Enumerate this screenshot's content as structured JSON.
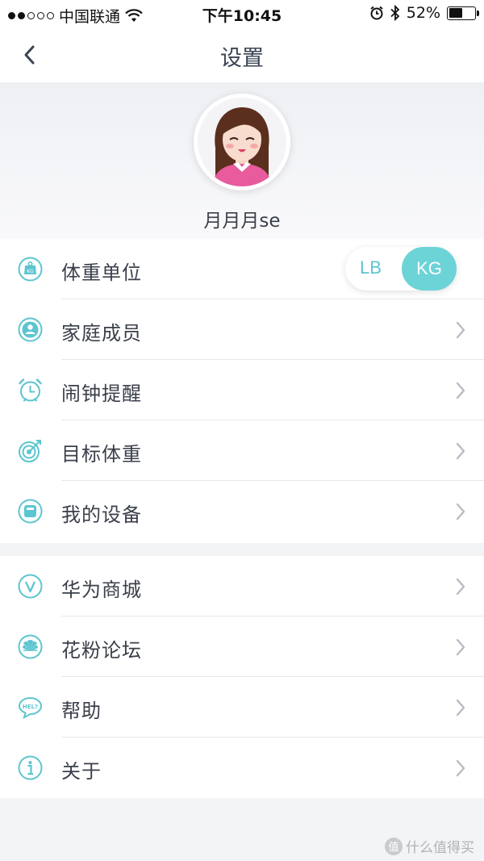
{
  "status_bar": {
    "carrier": "中国联通",
    "time": "下午10:45",
    "battery": "52%",
    "battery_level": 0.52,
    "signal_bars_filled": 2,
    "signal_bars_total": 5
  },
  "nav": {
    "title": "设置",
    "back_icon": "chevron-left-icon"
  },
  "profile": {
    "name": "月月月se",
    "avatar": "girl-avatar"
  },
  "unit_toggle": {
    "options": [
      "LB",
      "KG"
    ],
    "selected": "KG"
  },
  "group1": [
    {
      "label": "体重单位",
      "icon": "weight-scale-kg-icon",
      "name": "row-weight-unit",
      "control": "toggle"
    },
    {
      "label": "家庭成员",
      "icon": "family-member-icon",
      "name": "row-family-members",
      "control": "chevron"
    },
    {
      "label": "闹钟提醒",
      "icon": "alarm-clock-icon",
      "name": "row-alarm-reminder",
      "control": "chevron"
    },
    {
      "label": "目标体重",
      "icon": "target-icon",
      "name": "row-target-weight",
      "control": "chevron"
    },
    {
      "label": "我的设备",
      "icon": "device-icon",
      "name": "row-my-devices",
      "control": "chevron"
    }
  ],
  "group2": [
    {
      "label": "华为商城",
      "icon": "vmall-icon",
      "name": "row-huawei-mall",
      "control": "chevron"
    },
    {
      "label": "花粉论坛",
      "icon": "huawei-flower-icon",
      "name": "row-fans-forum",
      "control": "chevron"
    },
    {
      "label": "帮助",
      "icon": "help-bubble-icon",
      "name": "row-help",
      "control": "chevron"
    },
    {
      "label": "关于",
      "icon": "info-icon",
      "name": "row-about",
      "control": "chevron"
    }
  ],
  "watermark": {
    "text": "什么值得买",
    "icon_glyph": "值"
  },
  "colors": {
    "accent": "#5cc5cf",
    "toggle_active": "#6cd3d6",
    "background": "#f3f4f6",
    "text": "#3a3f4a",
    "chevron": "#b8bcc2"
  }
}
